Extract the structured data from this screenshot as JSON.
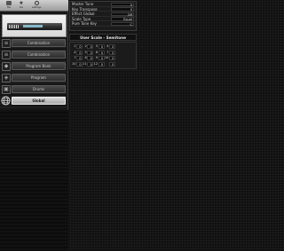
{
  "toolbar": {
    "buttons": [
      {
        "label": "file",
        "icon": "folder-icon"
      },
      {
        "label": "fav",
        "icon": "star-icon"
      },
      {
        "label": "settings",
        "icon": "gear-icon"
      }
    ]
  },
  "synth": {
    "icon": "synthesizer-icon"
  },
  "modes": [
    {
      "side_label": "Sound",
      "label": "Combination",
      "active": false
    },
    {
      "side_label": "Sound",
      "label": "Combination",
      "active": false
    },
    {
      "side_label": "",
      "label": "Program Bank",
      "active": false
    },
    {
      "side_label": "",
      "label": "Program",
      "active": false
    },
    {
      "side_label": "",
      "label": "Drums",
      "active": false
    },
    {
      "side_label": "",
      "label": "Global",
      "active": true
    }
  ],
  "global_params": [
    {
      "label": "Master Tune",
      "value": "0"
    },
    {
      "label": "Key Transpose",
      "value": "0"
    },
    {
      "label": "Effect Global",
      "value": "Off"
    },
    {
      "label": "Scale Type",
      "value": "Equal"
    },
    {
      "label": "Pure Tone Key",
      "value": "C"
    }
  ],
  "user_scale": {
    "title": "User Scale - Semitone",
    "rows": [
      [
        {
          "n": "1",
          "v": "0"
        },
        {
          "n": "2",
          "v": "0"
        },
        {
          "n": "3",
          "v": "0"
        },
        {
          "n": "4",
          "v": "0"
        }
      ],
      [
        {
          "n": "4",
          "v": "0"
        },
        {
          "n": "5",
          "v": "0"
        },
        {
          "n": "6",
          "v": "0"
        },
        {
          "n": "7",
          "v": "0"
        }
      ],
      [
        {
          "n": "7",
          "v": "0"
        },
        {
          "n": "8",
          "v": "0"
        },
        {
          "n": "9",
          "v": "0"
        },
        {
          "n": "10",
          "v": "0"
        }
      ],
      [
        {
          "n": "10",
          "v": "0"
        },
        {
          "n": "11",
          "v": "0"
        },
        {
          "n": "12",
          "v": "0"
        },
        {
          "n": "",
          "v": "0"
        }
      ]
    ]
  },
  "colors": {
    "accent": "#c8c8c8",
    "background": "#151515"
  }
}
